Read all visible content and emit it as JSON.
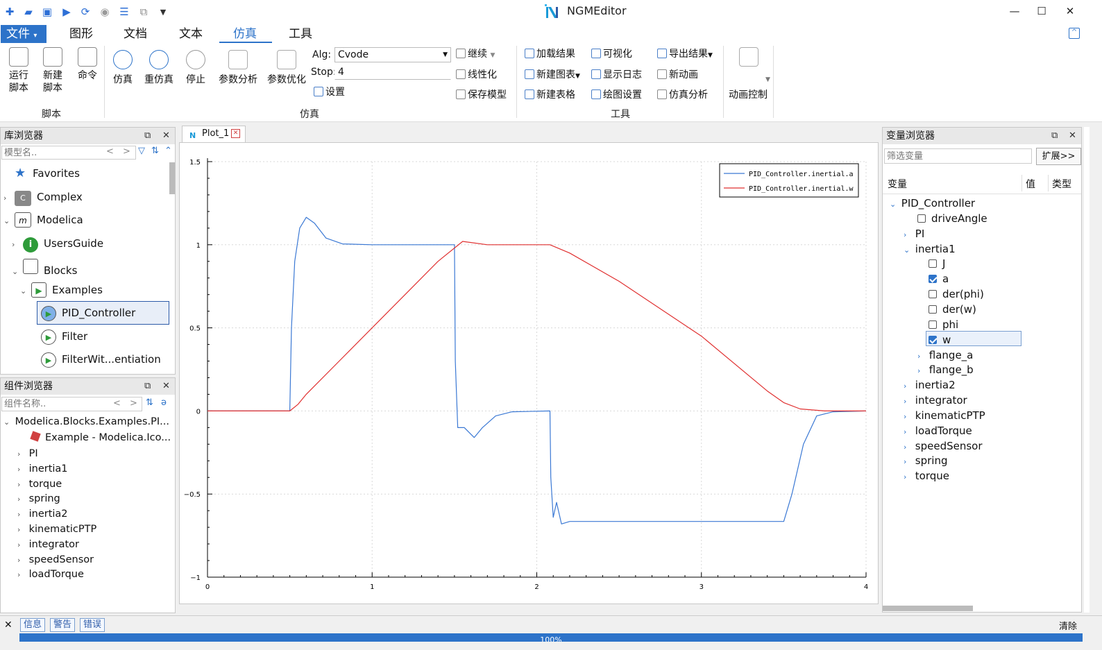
{
  "window": {
    "title": "NGMEditor"
  },
  "menu": {
    "tabs": [
      "文件",
      "图形",
      "文档",
      "文本",
      "仿真",
      "工具"
    ]
  },
  "ribbon": {
    "script_group": {
      "label": "脚本",
      "run_script": "运行\n脚本",
      "new_script": "新建\n脚本",
      "command": "命令"
    },
    "sim_group": {
      "label": "仿真",
      "simulate": "仿真",
      "resimulate": "重仿真",
      "stop": "停止",
      "param_analysis": "参数分析",
      "param_opt": "参数优化",
      "alg_label": "Alg:",
      "alg_value": "Cvode",
      "stop_label": "Stop:",
      "stop_value": "4",
      "settings": "设置",
      "continue": "继续",
      "linearize": "线性化",
      "save_model": "保存模型"
    },
    "tools_group": {
      "label": "工具",
      "load_results": "加载结果",
      "new_chart": "新建图表",
      "new_table": "新建表格",
      "visualize": "可视化",
      "show_log": "显示日志",
      "plot_settings": "绘图设置",
      "export_results": "导出结果",
      "new_animation": "新动画",
      "sim_analysis": "仿真分析"
    },
    "anim_group": {
      "label": "动画控制"
    }
  },
  "library_browser": {
    "title": "库浏览器",
    "search_placeholder": "模型名..",
    "items": [
      {
        "label": "Favorites"
      },
      {
        "label": "Complex"
      },
      {
        "label": "Modelica"
      },
      {
        "label": "UsersGuide"
      },
      {
        "label": "Blocks"
      },
      {
        "label": "Examples"
      },
      {
        "label": "PID_Controller"
      },
      {
        "label": "Filter"
      },
      {
        "label": "FilterWit...entiation"
      }
    ]
  },
  "component_browser": {
    "title": "组件浏览器",
    "search_placeholder": "组件名称..",
    "root": "Modelica.Blocks.Examples.PI...",
    "example": "Example - Modelica.Ico...",
    "items": [
      "PI",
      "inertia1",
      "torque",
      "spring",
      "inertia2",
      "kinematicPTP",
      "integrator",
      "speedSensor",
      "loadTorque"
    ]
  },
  "plot": {
    "tab_label": "Plot_1",
    "chart_data": {
      "type": "line",
      "xlim": [
        0,
        4
      ],
      "ylim": [
        -1,
        1.5
      ],
      "x_ticks": [
        "0",
        "1",
        "2",
        "3",
        "4"
      ],
      "y_ticks": [
        "1.5",
        "1",
        "0.5",
        "0",
        "−0.5",
        "−1"
      ],
      "grid": true,
      "legend_position": "top-right",
      "series": [
        {
          "name": "PID_Controller.inertial.a",
          "color": "#3a78d4",
          "points": [
            [
              0,
              0
            ],
            [
              0.5,
              0
            ],
            [
              0.51,
              0.5
            ],
            [
              0.53,
              0.9
            ],
            [
              0.56,
              1.1
            ],
            [
              0.6,
              1.165
            ],
            [
              0.65,
              1.13
            ],
            [
              0.72,
              1.04
            ],
            [
              0.82,
              1.005
            ],
            [
              1.0,
              1.0
            ],
            [
              1.5,
              1.0
            ],
            [
              1.505,
              0.3
            ],
            [
              1.52,
              -0.1
            ],
            [
              1.56,
              -0.1
            ],
            [
              1.62,
              -0.16
            ],
            [
              1.67,
              -0.1
            ],
            [
              1.75,
              -0.03
            ],
            [
              1.85,
              -0.005
            ],
            [
              2.08,
              0
            ],
            [
              2.085,
              -0.4
            ],
            [
              2.1,
              -0.64
            ],
            [
              2.12,
              -0.55
            ],
            [
              2.15,
              -0.68
            ],
            [
              2.2,
              -0.665
            ],
            [
              3.5,
              -0.665
            ],
            [
              3.55,
              -0.5
            ],
            [
              3.62,
              -0.2
            ],
            [
              3.7,
              -0.03
            ],
            [
              3.8,
              -0.005
            ],
            [
              4.0,
              0
            ]
          ]
        },
        {
          "name": "PID_Controller.inertial.w",
          "color": "#e03030",
          "points": [
            [
              0,
              0
            ],
            [
              0.5,
              0
            ],
            [
              0.55,
              0.04
            ],
            [
              0.6,
              0.1
            ],
            [
              0.8,
              0.3
            ],
            [
              1.0,
              0.5
            ],
            [
              1.2,
              0.7
            ],
            [
              1.4,
              0.9
            ],
            [
              1.55,
              1.02
            ],
            [
              1.7,
              1.0
            ],
            [
              2.08,
              1.0
            ],
            [
              2.2,
              0.95
            ],
            [
              2.5,
              0.78
            ],
            [
              3.0,
              0.45
            ],
            [
              3.4,
              0.12
            ],
            [
              3.5,
              0.05
            ],
            [
              3.6,
              0.012
            ],
            [
              3.75,
              0
            ],
            [
              4.0,
              0
            ]
          ]
        }
      ]
    }
  },
  "variable_browser": {
    "title": "变量浏览器",
    "filter_placeholder": "筛选变量",
    "expand_button": "扩展>>",
    "columns": [
      "变量",
      "值",
      "类型"
    ],
    "rows": [
      {
        "label": "PID_Controller"
      },
      {
        "label": "driveAngle"
      },
      {
        "label": "PI"
      },
      {
        "label": "inertia1"
      },
      {
        "label": "J"
      },
      {
        "label": "a"
      },
      {
        "label": "der(phi)"
      },
      {
        "label": "der(w)"
      },
      {
        "label": "phi"
      },
      {
        "label": "w"
      },
      {
        "label": "flange_a"
      },
      {
        "label": "flange_b"
      },
      {
        "label": "inertia2"
      },
      {
        "label": "integrator"
      },
      {
        "label": "kinematicPTP"
      },
      {
        "label": "loadTorque"
      },
      {
        "label": "speedSensor"
      },
      {
        "label": "spring"
      },
      {
        "label": "torque"
      }
    ]
  },
  "bottom": {
    "tabs": [
      "信息",
      "警告",
      "错误"
    ],
    "clear": "清除",
    "progress_text": "100%",
    "progress_value": 1.0
  },
  "colors": {
    "accent": "#2d73c9"
  }
}
